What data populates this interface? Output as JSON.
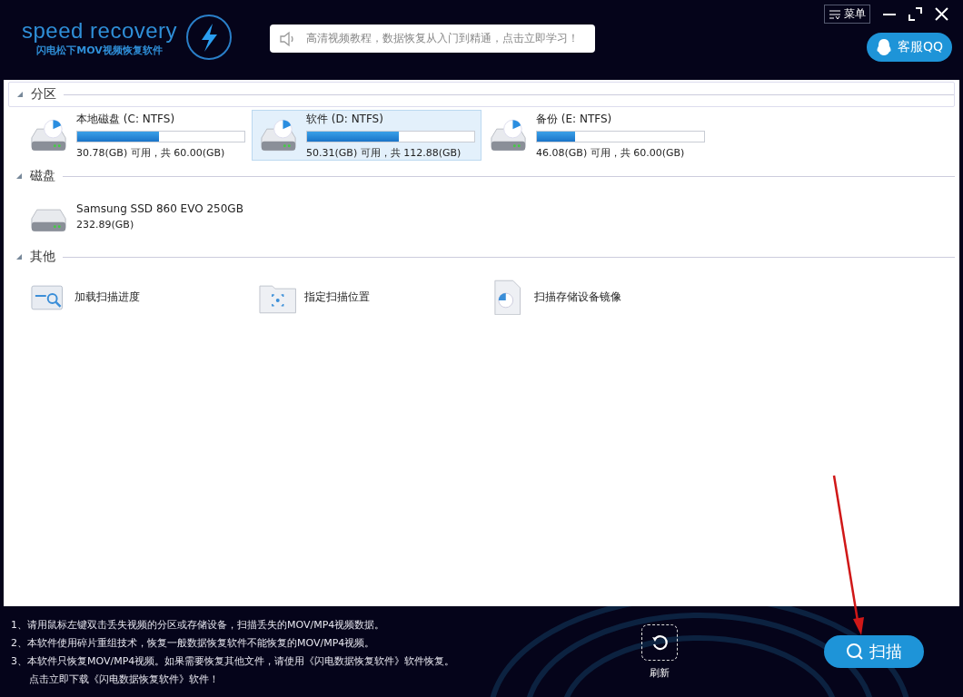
{
  "header": {
    "logo_title": "speed recovery",
    "logo_subtitle": "闪电松下MOV视频恢复软件",
    "notice": "高清视频教程，数据恢复从入门到精通，点击立即学习！",
    "menu_label": "菜单",
    "support_label": "客服QQ"
  },
  "sections": [
    {
      "title": "分区",
      "expanded": true,
      "items": [
        {
          "kind": "partition",
          "name": "本地磁盘 (C: NTFS)",
          "level": 0.49,
          "detail": "30.78(GB) 可用，共 60.00(GB)",
          "selected": false
        },
        {
          "kind": "partition",
          "name": "软件 (D: NTFS)",
          "level": 0.55,
          "detail": "50.31(GB) 可用，共 112.88(GB)",
          "selected": true
        },
        {
          "kind": "partition",
          "name": "备份 (E: NTFS)",
          "level": 0.23,
          "detail": "46.08(GB) 可用，共 60.00(GB)",
          "selected": false
        }
      ]
    },
    {
      "title": "磁盘",
      "expanded": true,
      "items": [
        {
          "kind": "disk",
          "name": "Samsung SSD 860 EVO 250GB",
          "detail": "232.89(GB)",
          "selected": false
        }
      ]
    },
    {
      "title": "其他",
      "expanded": true,
      "items": [
        {
          "kind": "load",
          "name": "加载扫描进度",
          "selected": false
        },
        {
          "kind": "location",
          "name": "指定扫描位置",
          "selected": false
        },
        {
          "kind": "image",
          "name": "扫描存储设备镜像",
          "selected": false
        }
      ]
    }
  ],
  "tips": [
    "1、请用鼠标左键双击丢失视频的分区或存储设备，扫描丢失的MOV/MP4视频数据。",
    "2、本软件使用碎片重组技术，恢复一般数据恢复软件不能恢复的MOV/MP4视频。",
    "3、本软件只恢复MOV/MP4视频。如果需要恢复其他文件，请使用《闪电数据恢复软件》软件恢复。"
  ],
  "download_link": "点击立即下载《闪电数据恢复软件》软件！",
  "refresh_label": "刷新",
  "scan_label": "扫描"
}
